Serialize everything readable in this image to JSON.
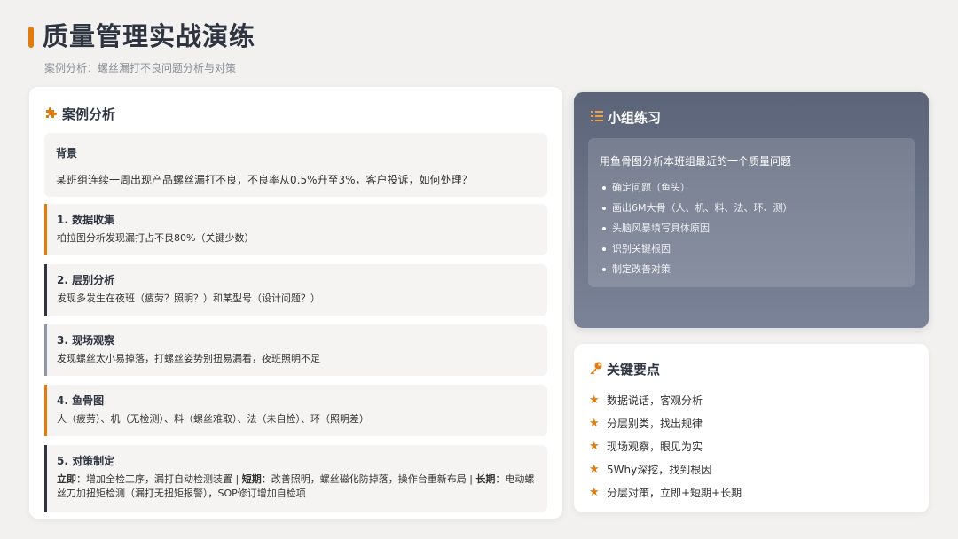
{
  "header": {
    "title": "质量管理实战演练",
    "subtitle": "案例分析：螺丝漏打不良问题分析与对策"
  },
  "case": {
    "icon": "puzzle-icon",
    "title": "案例分析",
    "background": {
      "label": "背景",
      "text": "某班组连续一周出现产品螺丝漏打不良，不良率从0.5%升至3%，客户投诉，如何处理？"
    },
    "steps": [
      {
        "label": "1. 数据收集",
        "text": "柏拉图分析发现漏打占不良80%（关键少数）"
      },
      {
        "label": "2. 层别分析",
        "text": "发现多发生在夜班（疲劳？照明？）和某型号（设计问题？）"
      },
      {
        "label": "3. 现场观察",
        "text": "发现螺丝太小易掉落，打螺丝姿势别扭易漏看，夜班照明不足"
      },
      {
        "label": "4. 鱼骨图",
        "text": "人（疲劳）、机（无检测）、料（螺丝难取）、法（未自检）、环（照明差）"
      },
      {
        "label": "5. 对策制定",
        "k1": "立即",
        "t1": "：增加全检工序，漏打自动检测装置 | ",
        "k2": "短期",
        "t2": "：改善照明，螺丝磁化防掉落，操作台重新布局 | ",
        "k3": "长期",
        "t3": "：电动螺丝刀加扭矩检测（漏打无扭矩报警），SOP修订增加自检项"
      }
    ]
  },
  "practice": {
    "icon": "list-icon",
    "title": "小组练习",
    "lead": "用鱼骨图分析本班组最近的一个质量问题",
    "items": [
      "确定问题（鱼头）",
      "画出6M大骨（人、机、料、法、环、测）",
      "头脑风暴填写具体原因",
      "识别关键根因",
      "制定改善对策"
    ]
  },
  "keypoints": {
    "icon": "key-icon",
    "title": "关键要点",
    "items": [
      "数据说话，客观分析",
      "分层别类，找出规律",
      "现场观察，眼见为实",
      "5Why深挖，找到根因",
      "分层对策，立即+短期+长期"
    ]
  },
  "colors": {
    "accent": "#e07b10",
    "dark": "#2e3646",
    "practice_bg": "#5b6478"
  }
}
